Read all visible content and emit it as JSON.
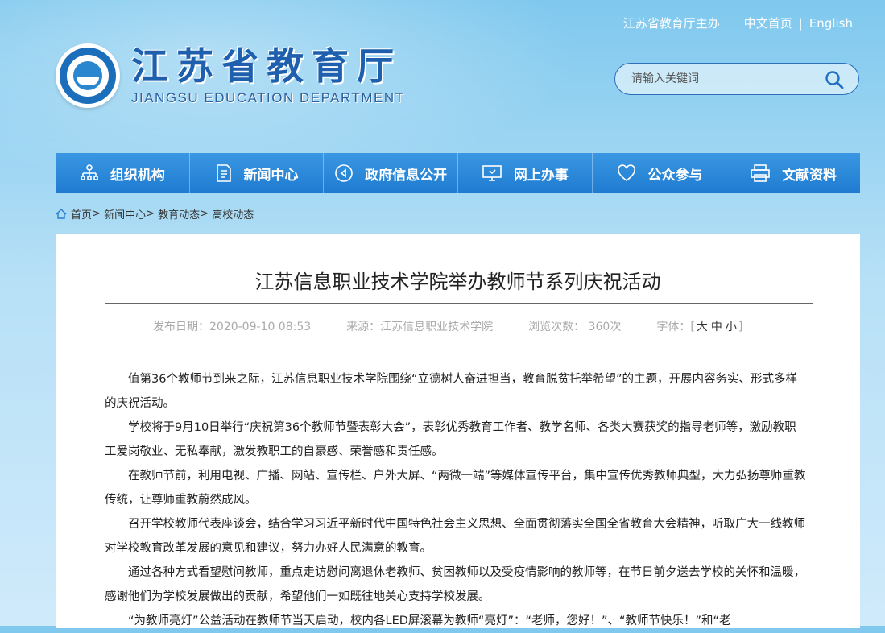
{
  "header": {
    "sponsor": "江苏省教育厅主办",
    "home_link": "中文首页",
    "separator": "|",
    "english_link": "English",
    "logo_cn": "江苏省教育厅",
    "logo_en": "JIANGSU EDUCATION DEPARTMENT"
  },
  "search": {
    "placeholder": "请输入关键词"
  },
  "nav": [
    {
      "label": "组织机构",
      "icon": "org-chart-icon"
    },
    {
      "label": "新闻中心",
      "icon": "document-icon"
    },
    {
      "label": "政府信息公开",
      "icon": "play-circle-icon"
    },
    {
      "label": "网上办事",
      "icon": "monitor-icon"
    },
    {
      "label": "公众参与",
      "icon": "heart-icon"
    },
    {
      "label": "文献资料",
      "icon": "printer-icon"
    }
  ],
  "breadcrumb": {
    "items": [
      "首页",
      "新闻中心",
      "教育动态",
      "高校动态"
    ],
    "sep": ">"
  },
  "article": {
    "title": "江苏信息职业技术学院举办教师节系列庆祝活动",
    "date": "发布日期：2020-09-10 08:53",
    "source": "来源：江苏信息职业技术学院",
    "views": "浏览次数： 360次",
    "font_label": "字体：",
    "bracket_open": "[",
    "bracket_close": "]",
    "font_sizes": [
      "大",
      "中",
      "小"
    ],
    "paragraphs": [
      "值第36个教师节到来之际，江苏信息职业技术学院围绕“立德树人奋进担当，教育脱贫托举希望”的主题，开展内容务实、形式多样的庆祝活动。",
      "学校将于9月10日举行“庆祝第36个教师节暨表彰大会”，表彰优秀教育工作者、教学名师、各类大赛获奖的指导老师等，激励教职工爱岗敬业、无私奉献，激发教职工的自豪感、荣誉感和责任感。",
      "在教师节前，利用电视、广播、网站、宣传栏、户外大屏、“两微一端”等媒体宣传平台，集中宣传优秀教师典型，大力弘扬尊师重教传统，让尊师重教蔚然成风。",
      "召开学校教师代表座谈会，结合学习习近平新时代中国特色社会主义思想、全面贯彻落实全国全省教育大会精神，听取广大一线教师对学校教育改革发展的意见和建议，努力办好人民满意的教育。",
      "通过各种方式看望慰问教师，重点走访慰问离退休老教师、贫困教师以及受疫情影响的教师等，在节日前夕送去学校的关怀和温暖，感谢他们为学校发展做出的贡献，希望他们一如既往地关心支持学校发展。",
      "“为教师亮灯”公益活动在教师节当天启动，校内各LED屏滚幕为教师“亮灯”：“老师，您好！”、“教师节快乐！”和“老"
    ]
  },
  "colors": {
    "nav_bg": "#2a88d8",
    "logo_text": "#1e5fae",
    "sky": "#9ad4f2"
  }
}
